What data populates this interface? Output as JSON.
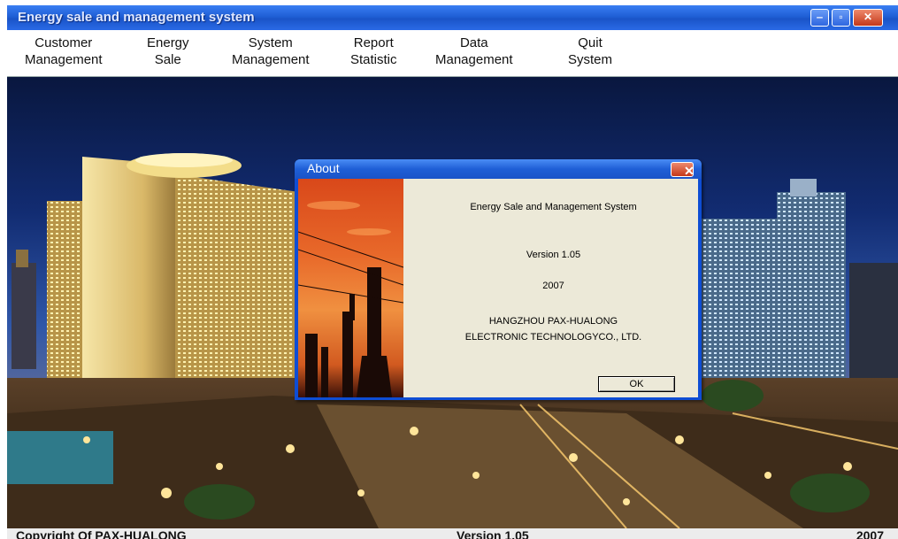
{
  "window": {
    "title": "Energy sale and management system"
  },
  "menu": [
    {
      "label": "Customer\nManagement"
    },
    {
      "label": "Energy\nSale"
    },
    {
      "label": "System\nManagement"
    },
    {
      "label": "Report\nStatistic"
    },
    {
      "label": "Data\nManagement"
    },
    {
      "label": "Quit\nSystem"
    }
  ],
  "dialog": {
    "title": "About",
    "product": "Energy Sale and Management  System",
    "version": "Version  1.05",
    "year": "2007",
    "company_line1": "HANGZHOU PAX-HUALONG",
    "company_line2": "ELECTRONIC TECHNOLOGYCO., LTD.",
    "ok_label": "OK"
  },
  "status": {
    "left": "Copyright Of PAX-HUALONG",
    "middle": "Version 1.05",
    "right": "2007"
  }
}
